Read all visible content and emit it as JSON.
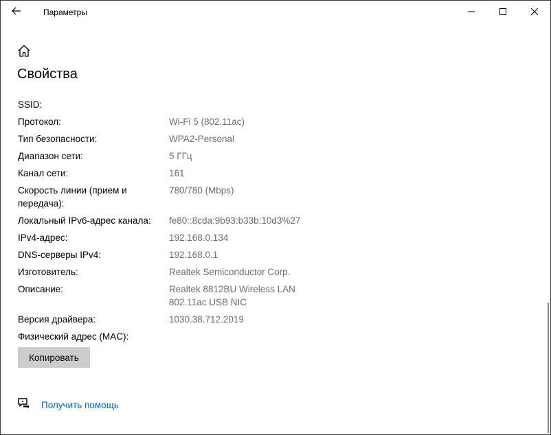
{
  "window": {
    "title": "Параметры"
  },
  "icons": {
    "back": "back-arrow-icon",
    "minimize": "minimize-icon",
    "maximize": "maximize-icon",
    "close": "close-icon",
    "home": "home-icon",
    "help": "help-chat-icon"
  },
  "page": {
    "title": "Свойства"
  },
  "properties": [
    {
      "label": "SSID:",
      "value": ""
    },
    {
      "label": "Протокол:",
      "value": "Wi-Fi 5 (802.11ac)"
    },
    {
      "label": "Тип безопасности:",
      "value": "WPA2-Personal"
    },
    {
      "label": "Диапазон сети:",
      "value": "5 ГГц"
    },
    {
      "label": "Канал сети:",
      "value": "161"
    },
    {
      "label": "Скорость линии (прием и передача):",
      "value": "780/780 (Mbps)"
    },
    {
      "label": "Локальный IPv6-адрес канала:",
      "value": "fe80::8cda:9b93:b33b:10d3%27"
    },
    {
      "label": "IPv4-адрес:",
      "value": "192.168.0.134"
    },
    {
      "label": "DNS-серверы IPv4:",
      "value": "192.168.0.1"
    },
    {
      "label": "Изготовитель:",
      "value": "Realtek Semiconductor Corp."
    },
    {
      "label": "Описание:",
      "value": "Realtek 8812BU Wireless LAN 802.11ac USB NIC"
    },
    {
      "label": "Версия драйвера:",
      "value": "1030.38.712.2019"
    },
    {
      "label": "Физический адрес (MAC):",
      "value": ""
    }
  ],
  "buttons": {
    "copy": "Копировать"
  },
  "help": {
    "link": "Получить помощь"
  },
  "colors": {
    "link": "#0063b1",
    "value_text": "#6b6b6b",
    "button_bg": "#cccccc"
  }
}
